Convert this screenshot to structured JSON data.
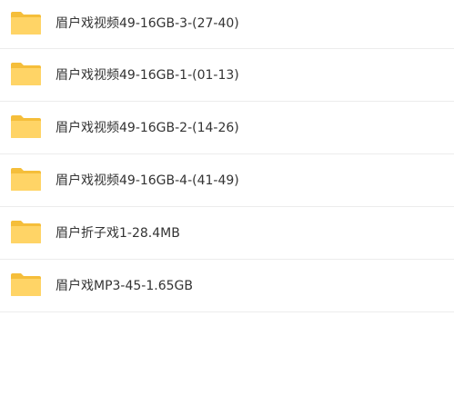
{
  "colors": {
    "folder_back": "#F5BE3A",
    "folder_front": "#FFD466",
    "text": "#333333",
    "divider": "#ECECEC"
  },
  "files": [
    {
      "name": "眉户戏视频49-16GB-3-(27-40)",
      "icon": "folder-icon"
    },
    {
      "name": "眉户戏视频49-16GB-1-(01-13)",
      "icon": "folder-icon"
    },
    {
      "name": "眉户戏视频49-16GB-2-(14-26)",
      "icon": "folder-icon"
    },
    {
      "name": "眉户戏视频49-16GB-4-(41-49)",
      "icon": "folder-icon"
    },
    {
      "name": "眉户折子戏1-28.4MB",
      "icon": "folder-icon"
    },
    {
      "name": "眉户戏MP3-45-1.65GB",
      "icon": "folder-icon"
    }
  ]
}
